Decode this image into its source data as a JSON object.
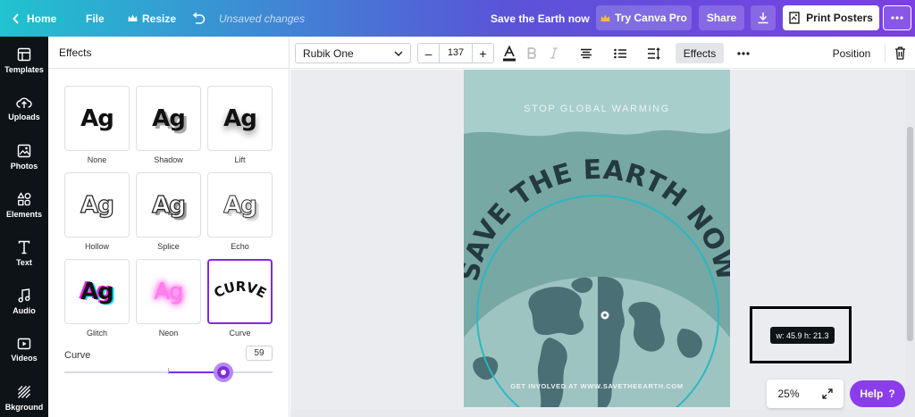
{
  "topbar": {
    "home": "Home",
    "file": "File",
    "resize": "Resize",
    "unsaved": "Unsaved changes",
    "doc_title": "Save the Earth now",
    "try_pro": "Try Canva Pro",
    "share": "Share",
    "print": "Print Posters"
  },
  "sidebar": {
    "items": [
      {
        "label": "Templates",
        "icon": "templates-icon"
      },
      {
        "label": "Uploads",
        "icon": "upload-icon"
      },
      {
        "label": "Photos",
        "icon": "photo-icon"
      },
      {
        "label": "Elements",
        "icon": "elements-icon"
      },
      {
        "label": "Text",
        "icon": "text-icon"
      },
      {
        "label": "Audio",
        "icon": "audio-icon"
      },
      {
        "label": "Videos",
        "icon": "video-icon"
      },
      {
        "label": "Bkground",
        "icon": "background-icon"
      }
    ]
  },
  "effects_panel": {
    "title": "Effects",
    "sample": "Ag",
    "curve_sample": "CURVE",
    "effects": [
      {
        "label": "None"
      },
      {
        "label": "Shadow"
      },
      {
        "label": "Lift"
      },
      {
        "label": "Hollow"
      },
      {
        "label": "Splice"
      },
      {
        "label": "Echo"
      },
      {
        "label": "Glitch"
      },
      {
        "label": "Neon"
      },
      {
        "label": "Curve",
        "selected": true
      }
    ],
    "curve_label": "Curve",
    "curve_value": "59",
    "curve_fraction": 0.59
  },
  "toolbar": {
    "font": "Rubik One",
    "size": "137",
    "minus": "–",
    "plus": "+",
    "effects": "Effects",
    "position": "Position"
  },
  "poster": {
    "top_text": "STOP GLOBAL WARMING",
    "curved_text": "SAVE THE EARTH NOW",
    "bottom_text": "GET INVOLVED AT WWW.SAVETHEEARTH.COM",
    "colors": {
      "bg": "#77a8a4",
      "top": "#a7cecb",
      "globe_ocean": "#9ec4c1",
      "land": "#4a6f75",
      "text": "#243a40",
      "circle": "#2ab8c4"
    }
  },
  "canvas": {
    "dimensions": "w: 45.9 h: 21.3",
    "zoom": "25%",
    "help": "Help",
    "help_mark": "?"
  },
  "colors": {
    "accent": "#7d2ae8",
    "sidebar": "#0e1318"
  }
}
